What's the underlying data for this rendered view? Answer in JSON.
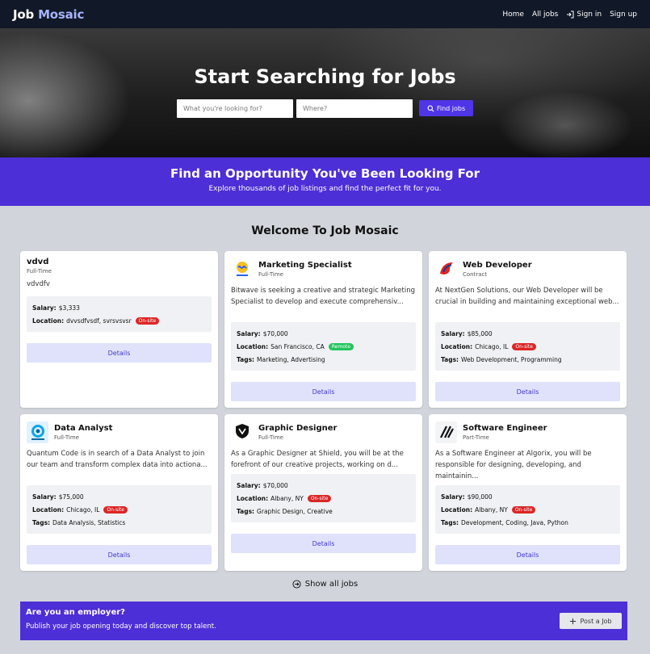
{
  "nav": {
    "brand_part1": "Job",
    "brand_part2": "Mosaic",
    "links": {
      "home": "Home",
      "all_jobs": "All jobs",
      "sign_in": "Sign in",
      "sign_up": "Sign up"
    }
  },
  "hero": {
    "title": "Start Searching for Jobs",
    "what_placeholder": "What you're looking for?",
    "where_placeholder": "Where?",
    "find_label": "Find jobs"
  },
  "banner": {
    "title": "Find an Opportunity You've Been Looking For",
    "subtitle": "Explore thousands of job listings and find the perfect fit for you."
  },
  "welcome": "Welcome To Job Mosaic",
  "jobs": [
    {
      "title": "vdvd",
      "type": "Full-Time",
      "description": "vdvdfv",
      "salary": "$3,333",
      "location": "dvvsdfvsdf, svrsvsvsr",
      "work_mode": "On-site",
      "tags": "",
      "logo_icon": "none",
      "details": "Details"
    },
    {
      "title": "Marketing Specialist",
      "type": "Full-Time",
      "description": "Bitwave is seeking a creative and strategic Marketing Specialist to develop and execute comprehensiv...",
      "salary": "$70,000",
      "location": "San Francisco, CA",
      "work_mode": "Remote",
      "tags": "Marketing, Advertising",
      "logo_icon": "bitwave-logo-icon",
      "details": "Details"
    },
    {
      "title": "Web Developer",
      "type": "Contract",
      "description": "At NextGen Solutions, our Web Developer will be crucial in building and maintaining exceptional web...",
      "salary": "$85,000",
      "location": "Chicago, IL",
      "work_mode": "On-site",
      "tags": "Web Development, Programming",
      "logo_icon": "nextgen-logo-icon",
      "details": "Details"
    },
    {
      "title": "Data Analyst",
      "type": "Full-Time",
      "description": "Quantum Code is in search of a Data Analyst to join our team and transform complex data into actiona...",
      "salary": "$75,000",
      "location": "Chicago, IL",
      "work_mode": "On-site",
      "tags": "Data Analysis, Statistics",
      "logo_icon": "quantum-code-logo-icon",
      "details": "Details"
    },
    {
      "title": "Graphic Designer",
      "type": "Full-Time",
      "description": "As a Graphic Designer at Shield, you will be at the forefront of our creative projects, working on d...",
      "salary": "$70,000",
      "location": "Albany, NY",
      "work_mode": "On-site",
      "tags": "Graphic Design, Creative",
      "logo_icon": "shield-logo-icon",
      "details": "Details"
    },
    {
      "title": "Software Engineer",
      "type": "Part-Time",
      "description": "As a Software Engineer at Algorix, you will be responsible for designing, developing, and maintainin...",
      "salary": "$90,000",
      "location": "Albany, NY",
      "work_mode": "On-site",
      "tags": "Development, Coding, Java, Python",
      "logo_icon": "algorix-logo-icon",
      "details": "Details"
    }
  ],
  "labels": {
    "salary": "Salary:",
    "location": "Location:",
    "tags": "Tags:"
  },
  "show_all": "Show all jobs",
  "employer": {
    "title": "Are you an employer?",
    "subtitle": "Publish your job opening today and discover top talent.",
    "post_label": "Post a Job"
  },
  "colors": {
    "nav": "#111827",
    "accent": "#4c2fd6",
    "on_site": "#dc2626",
    "remote": "#22c55e",
    "details_bg": "#e0e2fb"
  }
}
